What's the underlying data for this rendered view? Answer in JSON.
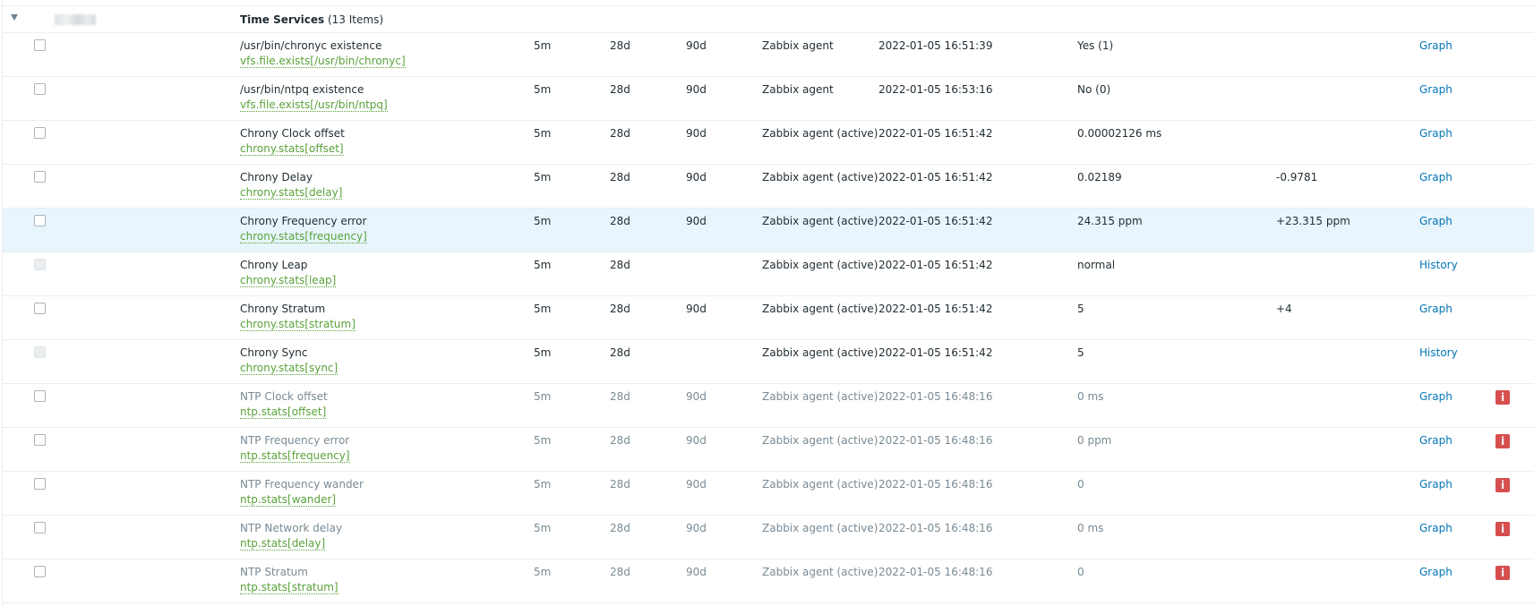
{
  "group": {
    "title": "Time Services",
    "count": "(13 Items)"
  },
  "rows": [
    {
      "name": "/usr/bin/chronyc existence",
      "key": "vfs.file.exists[/usr/bin/chronyc]",
      "interval": "5m",
      "history": "28d",
      "trends": "90d",
      "type": "Zabbix agent",
      "last_check": "2022-01-05 16:51:39",
      "last_value": "Yes (1)",
      "change": "",
      "link": "Graph"
    },
    {
      "name": "/usr/bin/ntpq existence",
      "key": "vfs.file.exists[/usr/bin/ntpq]",
      "interval": "5m",
      "history": "28d",
      "trends": "90d",
      "type": "Zabbix agent",
      "last_check": "2022-01-05 16:53:16",
      "last_value": "No (0)",
      "change": "",
      "link": "Graph"
    },
    {
      "name": "Chrony Clock offset",
      "key": "chrony.stats[offset]",
      "interval": "5m",
      "history": "28d",
      "trends": "90d",
      "type": "Zabbix agent (active)",
      "last_check": "2022-01-05 16:51:42",
      "last_value": "0.00002126 ms",
      "change": "",
      "link": "Graph"
    },
    {
      "name": "Chrony Delay",
      "key": "chrony.stats[delay]",
      "interval": "5m",
      "history": "28d",
      "trends": "90d",
      "type": "Zabbix agent (active)",
      "last_check": "2022-01-05 16:51:42",
      "last_value": "0.02189",
      "change": "-0.9781",
      "link": "Graph"
    },
    {
      "name": "Chrony Frequency error",
      "key": "chrony.stats[frequency]",
      "interval": "5m",
      "history": "28d",
      "trends": "90d",
      "type": "Zabbix agent (active)",
      "last_check": "2022-01-05 16:51:42",
      "last_value": "24.315 ppm",
      "change": "+23.315 ppm",
      "link": "Graph"
    },
    {
      "name": "Chrony Leap",
      "key": "chrony.stats[leap]",
      "interval": "5m",
      "history": "28d",
      "trends": "",
      "type": "Zabbix agent (active)",
      "last_check": "2022-01-05 16:51:42",
      "last_value": "normal",
      "change": "",
      "link": "History"
    },
    {
      "name": "Chrony Stratum",
      "key": "chrony.stats[stratum]",
      "interval": "5m",
      "history": "28d",
      "trends": "90d",
      "type": "Zabbix agent (active)",
      "last_check": "2022-01-05 16:51:42",
      "last_value": "5",
      "change": "+4",
      "link": "Graph"
    },
    {
      "name": "Chrony Sync",
      "key": "chrony.stats[sync]",
      "interval": "5m",
      "history": "28d",
      "trends": "",
      "type": "Zabbix agent (active)",
      "last_check": "2022-01-05 16:51:42",
      "last_value": "5",
      "change": "",
      "link": "History"
    },
    {
      "name": "NTP Clock offset",
      "key": "ntp.stats[offset]",
      "interval": "5m",
      "history": "28d",
      "trends": "90d",
      "type": "Zabbix agent (active)",
      "last_check": "2022-01-05 16:48:16",
      "last_value": "0 ms",
      "change": "",
      "link": "Graph",
      "info": "i"
    },
    {
      "name": "NTP Frequency error",
      "key": "ntp.stats[frequency]",
      "interval": "5m",
      "history": "28d",
      "trends": "90d",
      "type": "Zabbix agent (active)",
      "last_check": "2022-01-05 16:48:16",
      "last_value": "0 ppm",
      "change": "",
      "link": "Graph",
      "info": "i"
    },
    {
      "name": "NTP Frequency wander",
      "key": "ntp.stats[wander]",
      "interval": "5m",
      "history": "28d",
      "trends": "90d",
      "type": "Zabbix agent (active)",
      "last_check": "2022-01-05 16:48:16",
      "last_value": "0",
      "change": "",
      "link": "Graph",
      "info": "i"
    },
    {
      "name": "NTP Network delay",
      "key": "ntp.stats[delay]",
      "interval": "5m",
      "history": "28d",
      "trends": "90d",
      "type": "Zabbix agent (active)",
      "last_check": "2022-01-05 16:48:16",
      "last_value": "0 ms",
      "change": "",
      "link": "Graph",
      "info": "i"
    },
    {
      "name": "NTP Stratum",
      "key": "ntp.stats[stratum]",
      "interval": "5m",
      "history": "28d",
      "trends": "90d",
      "type": "Zabbix agent (active)",
      "last_check": "2022-01-05 16:48:16",
      "last_value": "0",
      "change": "",
      "link": "Graph",
      "info": "i"
    }
  ]
}
